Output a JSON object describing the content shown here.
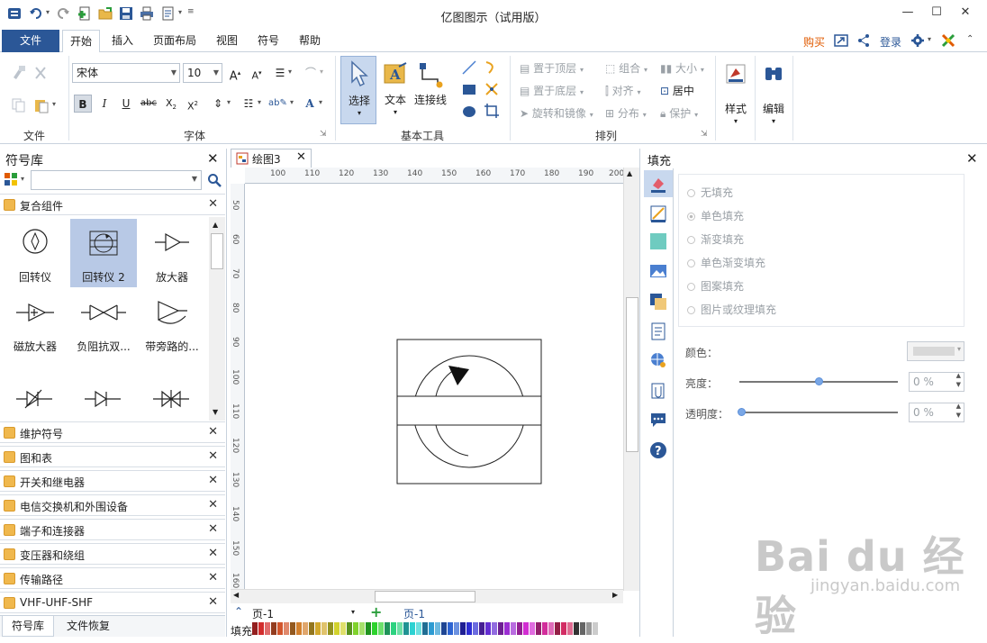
{
  "window": {
    "title": "亿图图示（试用版）",
    "min_glyph": "—",
    "max_glyph": "☐",
    "close_glyph": "✕"
  },
  "ribbon_tabs": {
    "file": "文件",
    "items": [
      "开始",
      "插入",
      "页面布局",
      "视图",
      "符号",
      "帮助"
    ],
    "active": "开始"
  },
  "right_actions": {
    "buy": "购买",
    "login": "登录"
  },
  "groups": {
    "file": "文件",
    "font": "字体",
    "basic_tools": "基本工具",
    "arrange": "排列"
  },
  "font": {
    "family": "宋体",
    "size": "10"
  },
  "basic_tools": {
    "select": "选择",
    "text": "文本",
    "connector": "连接线"
  },
  "arrange": {
    "bring_front": "置于顶层",
    "send_back": "置于底层",
    "rotate_mirror": "旋转和镜像",
    "group": "组合",
    "align": "对齐",
    "distribute": "分布",
    "size": "大小",
    "center": "居中",
    "protect": "保护"
  },
  "style_btn": "样式",
  "edit_btn": "编辑",
  "library": {
    "title": "符号库",
    "search_value": "",
    "open_category": "复合组件",
    "symbols": [
      {
        "label": "回转仪",
        "selected": false
      },
      {
        "label": "回转仪 2",
        "selected": true
      },
      {
        "label": "放大器",
        "selected": false
      },
      {
        "label": "磁放大器",
        "selected": false
      },
      {
        "label": "负阻抗双...",
        "selected": false
      },
      {
        "label": "带旁路的...",
        "selected": false
      }
    ],
    "categories": [
      "维护符号",
      "图和表",
      "开关和继电器",
      "电信交换机和外围设备",
      "端子和连接器",
      "变压器和绕组",
      "传输路径",
      "VHF-UHF-SHF"
    ],
    "bottom_tabs": [
      "符号库",
      "文件恢复"
    ]
  },
  "document": {
    "tab_name": "绘图3",
    "ruler_top": [
      "100",
      "110",
      "120",
      "130",
      "140",
      "150",
      "160",
      "170",
      "180",
      "190",
      "200"
    ],
    "ruler_left": [
      "50",
      "60",
      "70",
      "80",
      "90",
      "100",
      "110",
      "120",
      "130",
      "140",
      "150",
      "160"
    ],
    "page_selector": "页-1",
    "page_tab": "页-1",
    "fill_label": "填充"
  },
  "fill_panel": {
    "title": "填充",
    "options": [
      "无填充",
      "单色填充",
      "渐变填充",
      "单色渐变填充",
      "图案填充",
      "图片或纹理填充"
    ],
    "selected_option": "单色填充",
    "color_label": "颜色：",
    "brightness_label": "亮度：",
    "brightness_value": "0 %",
    "transparency_label": "透明度：",
    "transparency_value": "0 %"
  },
  "watermark": {
    "main": "Bai du 经验",
    "sub": "jingyan.baidu.com"
  },
  "colors": {
    "brand": "#2b5797",
    "buy": "#e05a00",
    "accent": "#4a7fd0"
  }
}
